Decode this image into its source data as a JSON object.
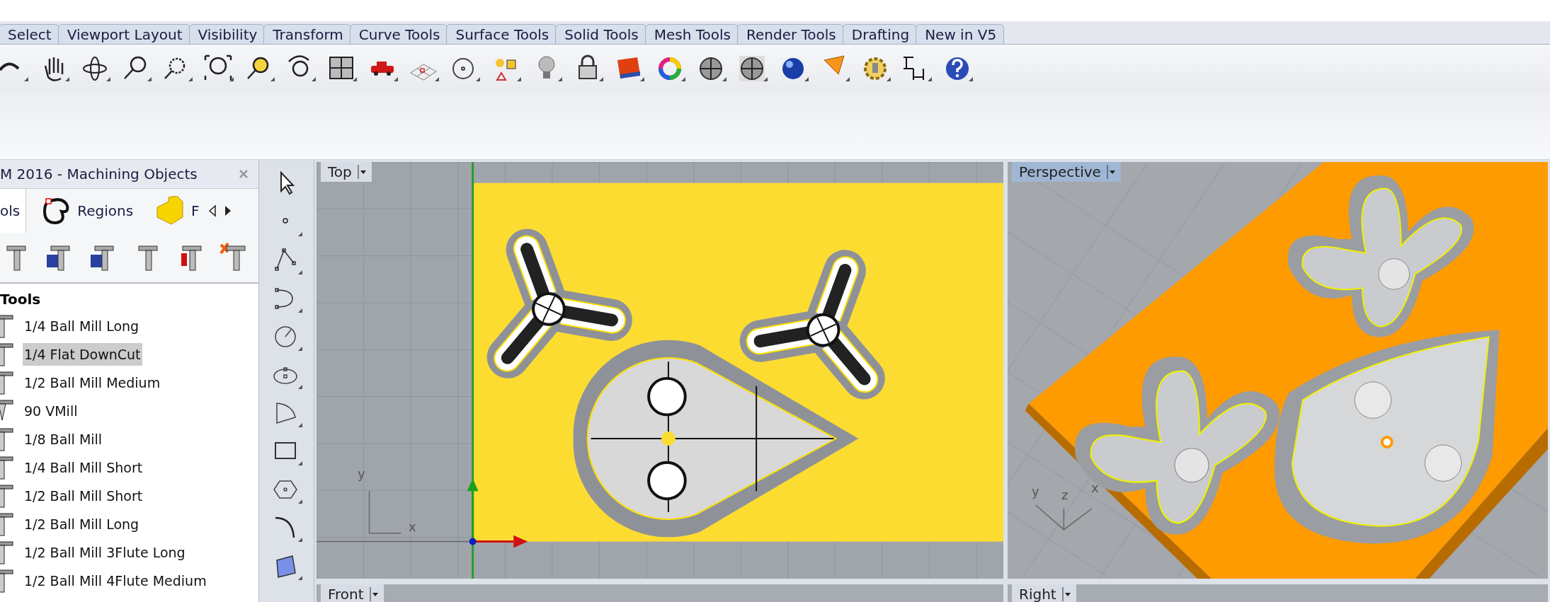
{
  "ribbon_tabs": [
    {
      "label": "Select"
    },
    {
      "label": "Viewport Layout"
    },
    {
      "label": "Visibility"
    },
    {
      "label": "Transform"
    },
    {
      "label": "Curve Tools"
    },
    {
      "label": "Surface Tools"
    },
    {
      "label": "Solid Tools"
    },
    {
      "label": "Mesh Tools"
    },
    {
      "label": "Render Tools"
    },
    {
      "label": "Drafting"
    },
    {
      "label": "New in V5"
    }
  ],
  "panel": {
    "title": "M 2016 - Machining Objects",
    "tabs": [
      {
        "label": "ols",
        "selected": true
      },
      {
        "label": "Regions",
        "selected": false
      },
      {
        "label": "F",
        "selected": false
      }
    ],
    "section": "Tools",
    "items": [
      {
        "label": "1/4 Ball Mill Long",
        "kind": "mill",
        "selected": false
      },
      {
        "label": "1/4 Flat DownCut",
        "kind": "mill",
        "selected": true
      },
      {
        "label": "1/2 Ball Mill Medium",
        "kind": "mill",
        "selected": false
      },
      {
        "label": "90 VMill",
        "kind": "vmill",
        "selected": false
      },
      {
        "label": "1/8 Ball Mill",
        "kind": "mill",
        "selected": false
      },
      {
        "label": "1/4 Ball Mill Short",
        "kind": "mill",
        "selected": false
      },
      {
        "label": "1/2 Ball Mill Short",
        "kind": "mill",
        "selected": false
      },
      {
        "label": "1/2 Ball Mill Long",
        "kind": "mill",
        "selected": false
      },
      {
        "label": "1/2 Ball Mill 3Flute Long",
        "kind": "mill",
        "selected": false
      },
      {
        "label": "1/2 Ball Mill 4Flute Medium",
        "kind": "mill",
        "selected": false
      }
    ]
  },
  "viewports": [
    {
      "label": "Top",
      "active": false,
      "axes": [
        "y",
        "x"
      ]
    },
    {
      "label": "Perspective",
      "active": true,
      "axes": [
        "y",
        "z",
        "x"
      ]
    }
  ],
  "bottom_viewports": [
    {
      "label": "Front"
    },
    {
      "label": "Right"
    }
  ]
}
